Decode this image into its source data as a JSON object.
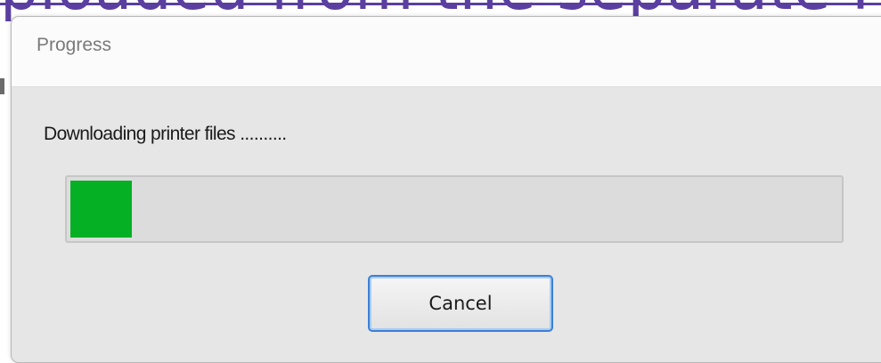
{
  "dialog": {
    "title": "Progress",
    "message": "Downloading printer files ..........",
    "progress": 0.08,
    "progress_color": "#06B025",
    "cancel_label": "Cancel"
  }
}
